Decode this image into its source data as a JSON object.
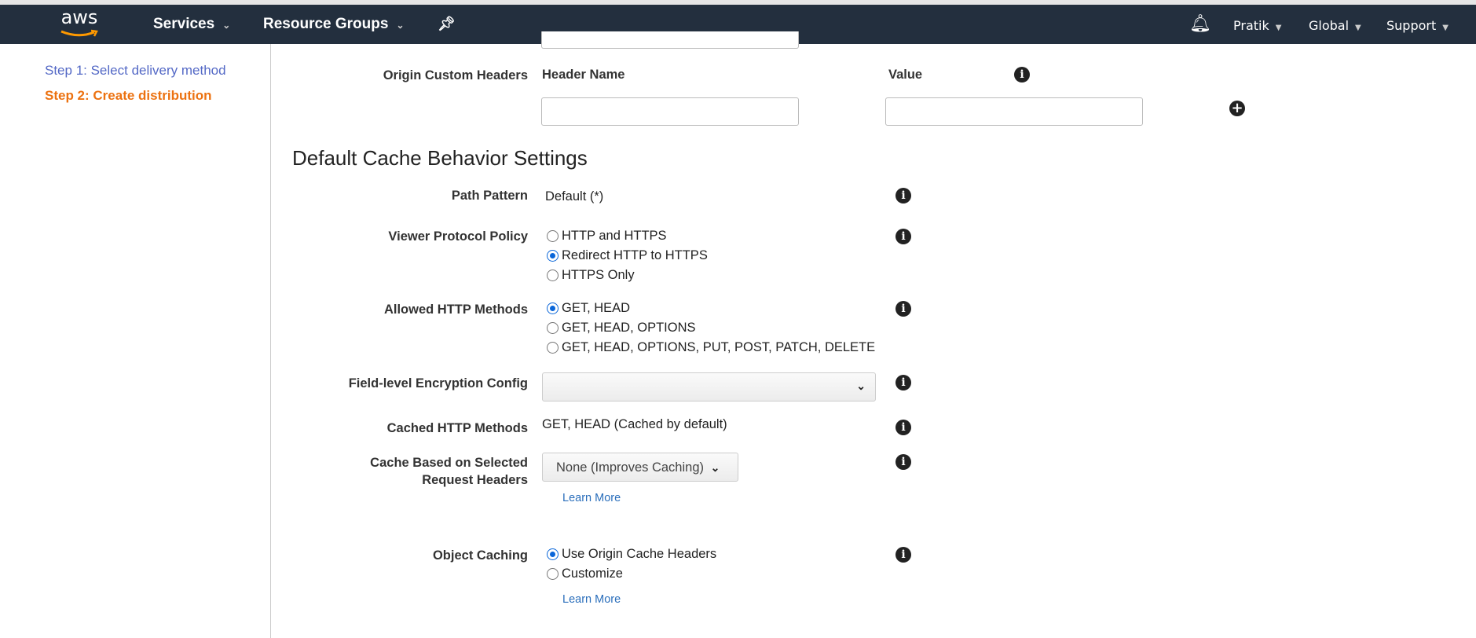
{
  "nav": {
    "logo": "aws",
    "services": "Services",
    "resource_groups": "Resource Groups",
    "user": "Pratik",
    "region": "Global",
    "support": "Support"
  },
  "sidebar": {
    "steps": [
      {
        "label": "Step 1: Select delivery method",
        "color": "#5469c6"
      },
      {
        "label": "Step 2: Create distribution",
        "color": "#ec7211"
      }
    ]
  },
  "origin_headers": {
    "label": "Origin Custom Headers",
    "header_name": "Header Name",
    "value": "Value",
    "header_name_value": "",
    "value_value": ""
  },
  "section_title": "Default Cache Behavior Settings",
  "path_pattern": {
    "label": "Path Pattern",
    "value": "Default (*)"
  },
  "viewer_protocol": {
    "label": "Viewer Protocol Policy",
    "options": [
      "HTTP and HTTPS",
      "Redirect HTTP to HTTPS",
      "HTTPS Only"
    ],
    "selected": 1
  },
  "allowed_methods": {
    "label": "Allowed HTTP Methods",
    "options": [
      "GET, HEAD",
      "GET, HEAD, OPTIONS",
      "GET, HEAD, OPTIONS, PUT, POST, PATCH, DELETE"
    ],
    "selected": 0
  },
  "fle_config": {
    "label": "Field-level Encryption Config",
    "value": ""
  },
  "cached_methods": {
    "label": "Cached HTTP Methods",
    "value": "GET, HEAD (Cached by default)"
  },
  "cache_headers": {
    "label_line1": "Cache Based on Selected",
    "label_line2": "Request Headers",
    "value": "None (Improves Caching)",
    "learn_more": "Learn More"
  },
  "object_caching": {
    "label": "Object Caching",
    "options": [
      "Use Origin Cache Headers",
      "Customize"
    ],
    "selected": 0,
    "learn_more": "Learn More"
  }
}
